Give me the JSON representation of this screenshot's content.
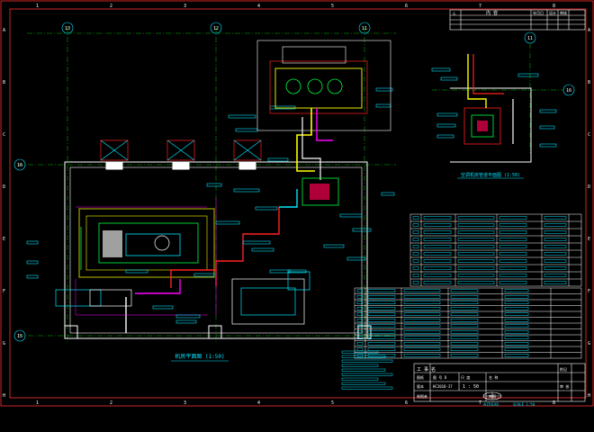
{
  "sheet": {
    "border_color": "#ff3030",
    "col_numbers": [
      "1",
      "2",
      "3",
      "4",
      "5",
      "6",
      "7",
      "8"
    ],
    "row_letters": [
      "A",
      "B",
      "C",
      "D",
      "E",
      "F",
      "G",
      "H"
    ]
  },
  "grid_bubbles": {
    "c13": "13",
    "c12": "12",
    "c11": "11",
    "c11b": "11",
    "r16": "16",
    "r15": "15",
    "r16b": "16"
  },
  "views": {
    "plan_caption": "机房平面图 (1:50)",
    "detail_caption": "空调机房管道平面图 (1:50)"
  },
  "revision_table": {
    "cols": [
      "△",
      "内 容",
      "年月日",
      "设计",
      "审核"
    ]
  },
  "title_block": {
    "project_label": "工 事 名",
    "drawing_no_label": "图纸",
    "drawing_no": "图 号 D",
    "version_label": "版本",
    "version": "HC2018-37",
    "scale_label": "尺 度",
    "scale": "1 : 50",
    "name_label": "名 称",
    "designer_label": "制图者",
    "reviewer_label": "审图",
    "notes_label": "附记",
    "check_label": "审 核",
    "footer_left": "AUTOCAD",
    "footer_right": "SCALE 1:50"
  },
  "colors": {
    "cyan": "#00e5ff",
    "red": "#ff2020",
    "yellow": "#ffff00",
    "green": "#00ff40",
    "magenta": "#ff00ff",
    "white": "#ffffff",
    "olive": "#a0a000",
    "grid_green": "#00c000"
  }
}
